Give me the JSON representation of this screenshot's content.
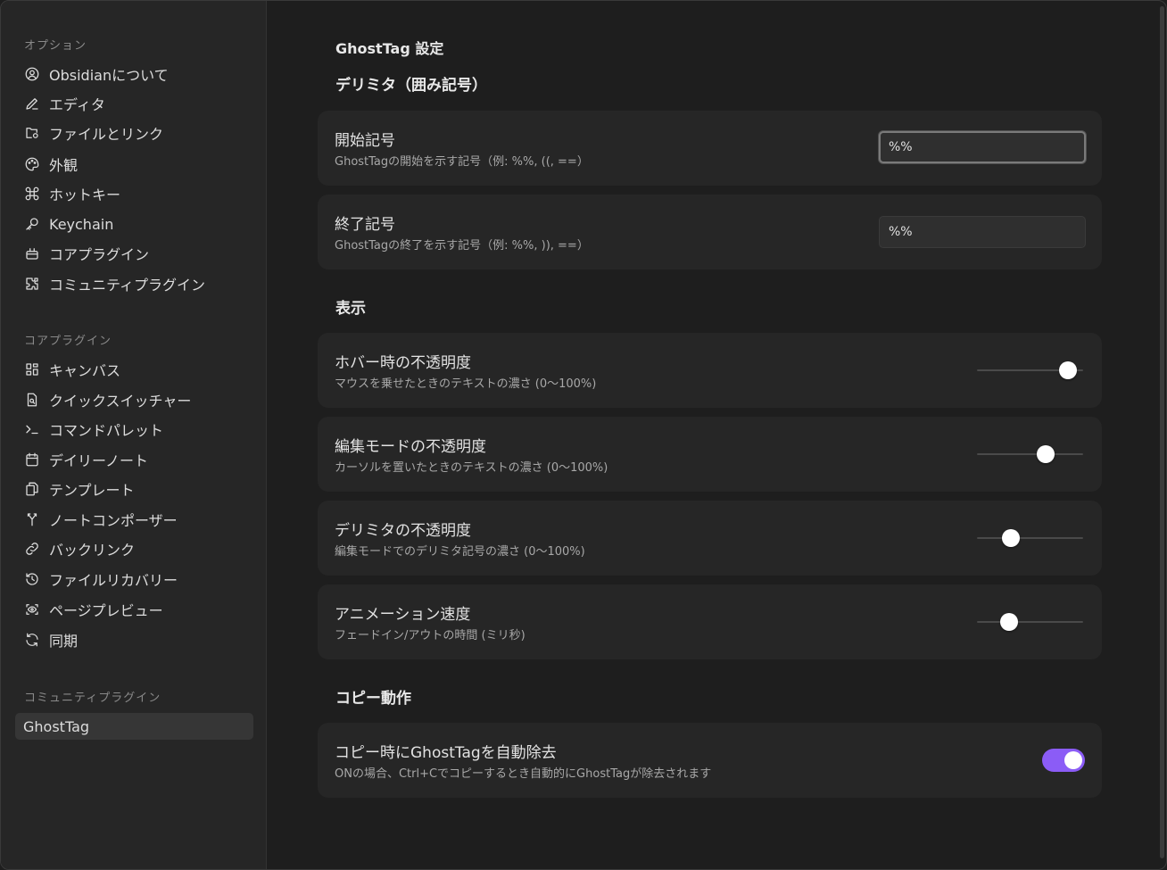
{
  "sidebar": {
    "options_title": "オプション",
    "options_items": [
      {
        "label": "Obsidianについて",
        "icon": "user-circle-icon"
      },
      {
        "label": "エディタ",
        "icon": "pencil-icon"
      },
      {
        "label": "ファイルとリンク",
        "icon": "folder-cog-icon"
      },
      {
        "label": "外観",
        "icon": "palette-icon"
      },
      {
        "label": "ホットキー",
        "icon": "command-icon"
      },
      {
        "label": "Keychain",
        "icon": "key-icon"
      },
      {
        "label": "コアプラグイン",
        "icon": "plug-box-icon"
      },
      {
        "label": "コミュニティプラグイン",
        "icon": "puzzle-icon"
      }
    ],
    "core_title": "コアプラグイン",
    "core_items": [
      {
        "label": "キャンバス",
        "icon": "layout-dashboard-icon"
      },
      {
        "label": "クイックスイッチャー",
        "icon": "file-search-icon"
      },
      {
        "label": "コマンドパレット",
        "icon": "terminal-icon"
      },
      {
        "label": "デイリーノート",
        "icon": "calendar-icon"
      },
      {
        "label": "テンプレート",
        "icon": "files-icon"
      },
      {
        "label": "ノートコンポーザー",
        "icon": "merge-icon"
      },
      {
        "label": "バックリンク",
        "icon": "link-icon"
      },
      {
        "label": "ファイルリカバリー",
        "icon": "history-icon"
      },
      {
        "label": "ページプレビュー",
        "icon": "scan-eye-icon"
      },
      {
        "label": "同期",
        "icon": "refresh-icon"
      }
    ],
    "community_title": "コミュニティプラグイン",
    "community_items": [
      {
        "label": "GhostTag",
        "active": true
      }
    ]
  },
  "main": {
    "page_title": "GhostTag 設定",
    "delimiter_heading": "デリミタ（囲み記号）",
    "start": {
      "name": "開始記号",
      "desc": "GhostTagの開始を示す記号（例: %%, ((, ==）",
      "value": "%%"
    },
    "end": {
      "name": "終了記号",
      "desc": "GhostTagの終了を示す記号（例: %%, )), ==）",
      "value": "%%"
    },
    "display_heading": "表示",
    "hover_opacity": {
      "name": "ホバー時の不透明度",
      "desc": "マウスを乗せたときのテキストの濃さ (0〜100%)",
      "level": 0.86
    },
    "edit_opacity": {
      "name": "編集モードの不透明度",
      "desc": "カーソルを置いたときのテキストの濃さ (0〜100%)",
      "level": 0.65
    },
    "delimiter_opacity": {
      "name": "デリミタの不透明度",
      "desc": "編集モードでのデリミタ記号の濃さ (0〜100%)",
      "level": 0.32
    },
    "animation_speed": {
      "name": "アニメーション速度",
      "desc": "フェードイン/アウトの時間 (ミリ秒)",
      "level": 0.3
    },
    "copy_heading": "コピー動作",
    "copy_strip": {
      "name": "コピー時にGhostTagを自動除去",
      "desc": "ONの場合、Ctrl+Cでコピーするとき自動的にGhostTagが除去されます",
      "enabled": true
    }
  },
  "colors": {
    "accent": "#8b5cf6",
    "background": "#1e1e1e",
    "sidebar": "#262626",
    "card": "#262626"
  }
}
